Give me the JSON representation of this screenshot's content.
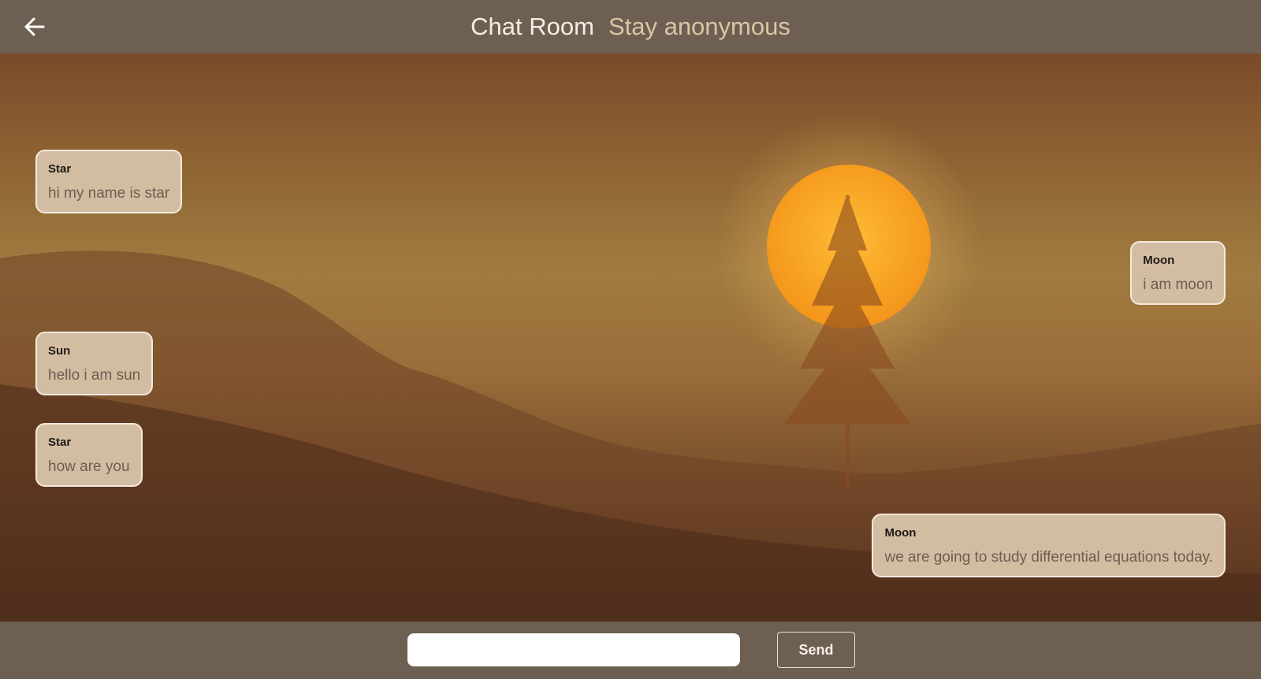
{
  "header": {
    "title": "Chat Room",
    "subtitle": "Stay anonymous",
    "back_icon": "arrow-left-icon"
  },
  "messages": [
    {
      "sender": "Star",
      "text": "hi my name is star",
      "side": "left"
    },
    {
      "sender": "Moon",
      "text": "i am moon",
      "side": "right"
    },
    {
      "sender": "Sun",
      "text": "hello i am sun",
      "side": "left"
    },
    {
      "sender": "Star",
      "text": "how are you",
      "side": "left"
    },
    {
      "sender": "Moon",
      "text": "we are going to study differential equations today.",
      "side": "right"
    }
  ],
  "composer": {
    "input_value": "",
    "input_placeholder": "",
    "send_label": "Send"
  },
  "colors": {
    "bar_background": "#6d6052",
    "bubble_background": "#d3bda2",
    "bubble_border": "#f3e9dc",
    "sun": "#ffb12a"
  }
}
